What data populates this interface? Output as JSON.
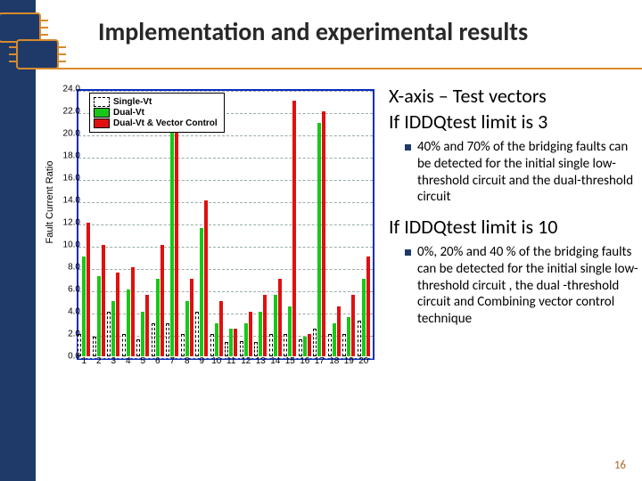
{
  "title": "Implementation and experimental results",
  "page_number": "16",
  "rhs": {
    "line1": "X-axis – Test vectors",
    "line2": "If IDDQtest limit is 3",
    "bullet1": "40% and 70% of the bridging faults can be detected for the initial single low-threshold circuit and the dual-threshold circuit",
    "line3": "If IDDQtest limit is 10",
    "bullet2": "0%, 20% and 40 % of the bridging faults can be detected for the initial single low-threshold circuit , the dual -threshold circuit and Combining vector control technique"
  },
  "chart_data": {
    "type": "bar",
    "title": "",
    "xlabel": "",
    "ylabel": "Fault Current Ratio",
    "ylim": [
      0,
      24
    ],
    "yticks": [
      0,
      2,
      4,
      6,
      8,
      10,
      12,
      14,
      16,
      18,
      20,
      22,
      24
    ],
    "categories": [
      "1",
      "2",
      "3",
      "4",
      "5",
      "6",
      "7",
      "8",
      "9",
      "10",
      "11",
      "12",
      "13",
      "14",
      "15",
      "16",
      "17",
      "18",
      "19",
      "20"
    ],
    "series": [
      {
        "name": "Single-Vt",
        "values": [
          2.0,
          1.8,
          4.0,
          2.0,
          1.5,
          3.0,
          3.0,
          2.0,
          4.0,
          2.0,
          1.3,
          1.4,
          1.3,
          2.0,
          2.0,
          1.5,
          2.5,
          2.0,
          2.0,
          3.2
        ]
      },
      {
        "name": "Dual-Vt",
        "values": [
          9.0,
          7.2,
          5.0,
          6.0,
          4.0,
          7.0,
          21.0,
          5.0,
          11.5,
          3.0,
          2.5,
          3.0,
          4.0,
          5.5,
          4.5,
          1.8,
          21.0,
          3.0,
          3.5,
          7.0
        ]
      },
      {
        "name": "Dual-Vt & Vector Control",
        "values": [
          12.0,
          10.0,
          7.5,
          8.0,
          5.5,
          10.0,
          22.5,
          7.0,
          14.0,
          5.0,
          2.5,
          4.0,
          5.5,
          7.0,
          23.0,
          2.0,
          22.0,
          4.5,
          5.5,
          9.0
        ]
      }
    ],
    "legend_position": "upper-left",
    "grid": true
  }
}
